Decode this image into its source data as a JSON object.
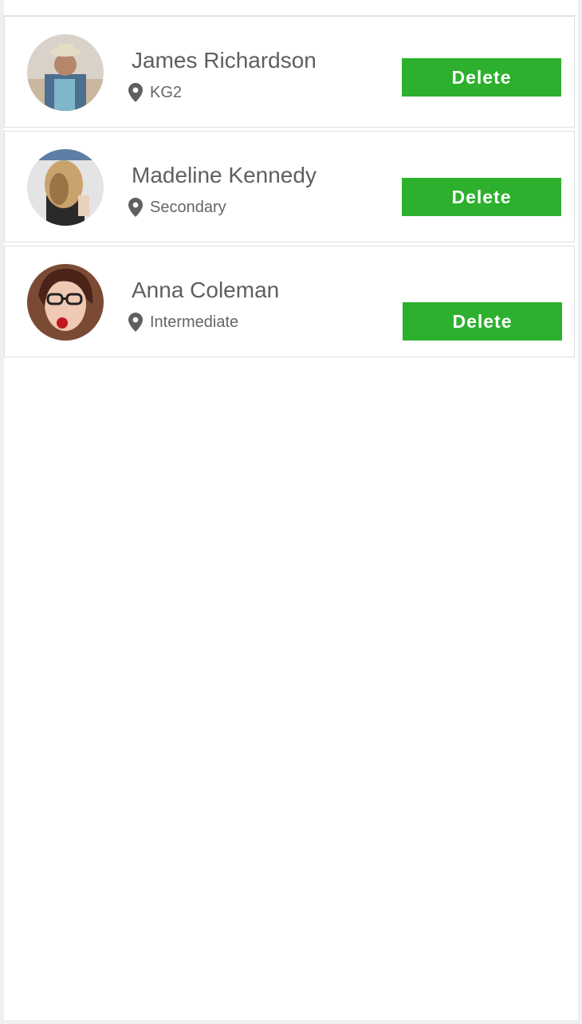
{
  "colors": {
    "accent_green": "#2db02d",
    "text_primary": "#5f5f5f",
    "text_secondary": "#666666",
    "divider": "#dedede",
    "background": "#efefef"
  },
  "students": [
    {
      "name": "James Richardson",
      "level": "KG2",
      "level_icon": "location-pin-icon",
      "action_label": "Delete"
    },
    {
      "name": "Madeline Kennedy",
      "level": "Secondary",
      "level_icon": "location-pin-icon",
      "action_label": "Delete"
    },
    {
      "name": "Anna Coleman",
      "level": "Intermediate",
      "level_icon": "location-pin-icon",
      "action_label": "Delete"
    }
  ]
}
